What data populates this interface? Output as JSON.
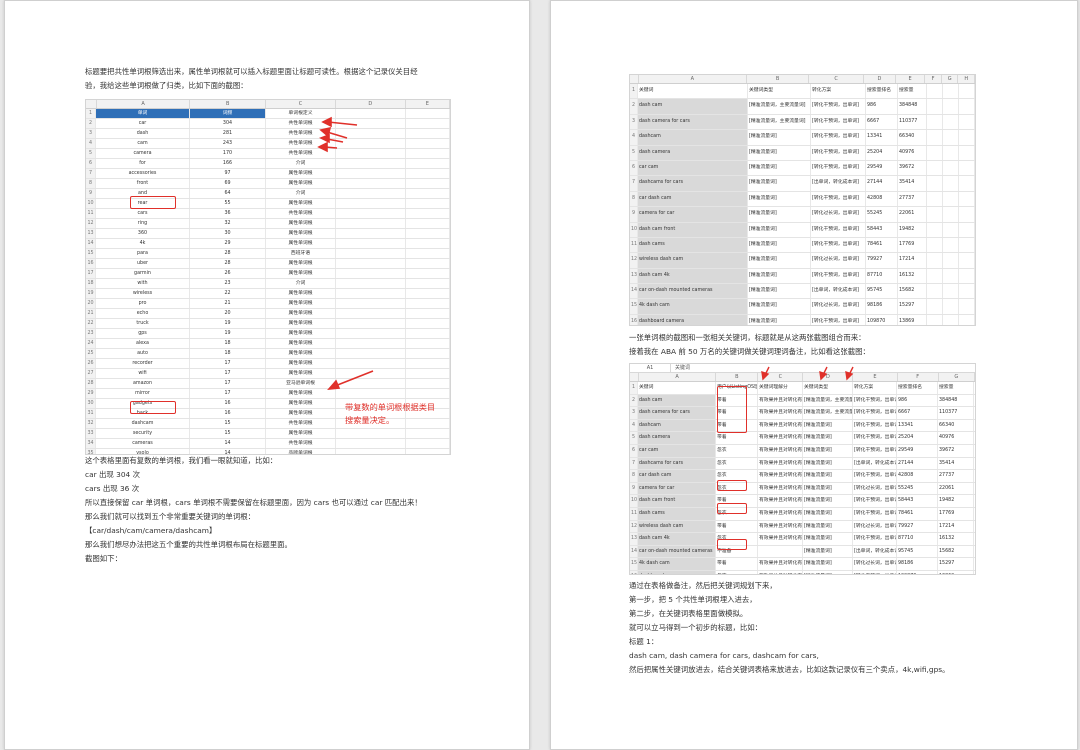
{
  "left_page": {
    "intro": [
      "标题要把共性单词根筛选出来，属性单词根就可以插入标题里面让标题可读性。根据这个记录仪关目经",
      "验，我给这些单词根做了归类，比如下面的截图："
    ],
    "sheet1": {
      "col_letters": [
        "",
        "A",
        "B",
        "C",
        "D",
        "E"
      ],
      "header": [
        "单词",
        "词频",
        "单词根定义"
      ],
      "rows": [
        [
          "car",
          "304",
          "共性单词根"
        ],
        [
          "dash",
          "281",
          "共性单词根"
        ],
        [
          "cam",
          "243",
          "共性单词根"
        ],
        [
          "camera",
          "170",
          "共性单词根"
        ],
        [
          "for",
          "166",
          "介词"
        ],
        [
          "accessories",
          "97",
          "属性单词根"
        ],
        [
          "front",
          "69",
          "属性单词根"
        ],
        [
          "and",
          "64",
          "介词"
        ],
        [
          "rear",
          "55",
          "属性单词根"
        ],
        [
          "cars",
          "36",
          "共性单词根"
        ],
        [
          "ring",
          "32",
          "属性单词根"
        ],
        [
          "360",
          "30",
          "属性单词根"
        ],
        [
          "4k",
          "29",
          "属性单词根"
        ],
        [
          "para",
          "28",
          "西班牙语"
        ],
        [
          "uber",
          "28",
          "属性单词根"
        ],
        [
          "garmin",
          "26",
          "属性单词根"
        ],
        [
          "with",
          "23",
          "介词"
        ],
        [
          "wireless",
          "22",
          "属性单词根"
        ],
        [
          "pro",
          "21",
          "属性单词根"
        ],
        [
          "echo",
          "20",
          "属性单词根"
        ],
        [
          "truck",
          "19",
          "属性单词根"
        ],
        [
          "gps",
          "19",
          "属性单词根"
        ],
        [
          "alexa",
          "18",
          "属性单词根"
        ],
        [
          "auto",
          "18",
          "属性单词根"
        ],
        [
          "recorder",
          "17",
          "属性单词根"
        ],
        [
          "wifi",
          "17",
          "属性单词根"
        ],
        [
          "amazon",
          "17",
          "亚马逊单词根"
        ],
        [
          "mirror",
          "17",
          "属性单词根"
        ],
        [
          "gadgets",
          "16",
          "属性单词根"
        ],
        [
          "back",
          "16",
          "属性单词根"
        ],
        [
          "dashcam",
          "15",
          "共性单词根"
        ],
        [
          "security",
          "15",
          "属性单词根"
        ],
        [
          "cameras",
          "14",
          "共性单词根"
        ],
        [
          "vsolo",
          "14",
          "品牌单词根"
        ],
        [
          "mini",
          "14",
          "属性单词根"
        ],
        [
          "men",
          "14",
          "属性单词根"
        ],
        [
          "women",
          "13",
          "属性单词根"
        ],
        [
          "camara",
          "13",
          "属性单词根"
        ]
      ],
      "annotation": [
        "带复数的单词根根据类目",
        "搜索量决定。"
      ]
    },
    "body": [
      "这个表格里面有复数的单词根，我们看一眼就知道，比如：",
      "car 出现 304 次",
      "cars 出现 36 次",
      "所以直接保留 car 单词根，cars 单词根不需要保留在标题里面，因为 cars 也可以通过 car 匹配出来！",
      "那么我们就可以找到五个非常重要关键词的单词根：",
      "【car/dash/cam/camera/dashcam】",
      "那么我们想尽办法把这五个重要的共性单词根布局在标题里面。",
      "截图如下："
    ]
  },
  "right_page": {
    "sheet2": {
      "col_letters": [
        "",
        "A",
        "B",
        "C",
        "D",
        "E",
        "F",
        "G",
        "H"
      ],
      "header": [
        "关键词",
        "关键词类型",
        "转化方案",
        "搜索量排名",
        "搜索量"
      ],
      "rows": [
        [
          "dash cam",
          "[精准流量词，主要流量词]",
          "[转化干预词，出单词]",
          "986",
          "384848"
        ],
        [
          "dash camera for cars",
          "[精准流量词，主要流量词]",
          "[转化干预词，出单词]",
          "6667",
          "110377"
        ],
        [
          "dashcam",
          "[精准流量词]",
          "[转化干预词，出单词]",
          "13341",
          "66340"
        ],
        [
          "dash camera",
          "[精准流量词]",
          "[转化干预词，出单词]",
          "25204",
          "40976"
        ],
        [
          "car cam",
          "[精准流量词]",
          "[转化干预词，出单词]",
          "29549",
          "39672"
        ],
        [
          "dashcams for cars",
          "[精准流量词]",
          "[出单词，转化成本词]",
          "27144",
          "35414"
        ],
        [
          "car dash cam",
          "[精准流量词]",
          "[转化干预词，出单词]",
          "42808",
          "27737"
        ],
        [
          "camera for car",
          "[精准流量词]",
          "[转化过长词，出单词]",
          "55245",
          "22061"
        ],
        [
          "dash cam front",
          "[精准流量词]",
          "[转化干预词，出单词]",
          "58443",
          "19482"
        ],
        [
          "dash cams",
          "[精准流量词]",
          "[转化干预词，出单词]",
          "78461",
          "17769"
        ],
        [
          "wireless dash cam",
          "[精准流量词]",
          "[转化过长词，出单词]",
          "79927",
          "17214"
        ],
        [
          "dash cam 4k",
          "[精准流量词]",
          "[转化干预词，出单词]",
          "87710",
          "16132"
        ],
        [
          "car on-dash mounted cameras",
          "[精准流量词]",
          "[出单词，转化成本词]",
          "95745",
          "15682"
        ],
        [
          "4k dash cam",
          "[精准流量词]",
          "[转化过长词，出单词]",
          "98186",
          "15297"
        ],
        [
          "dashboard camera",
          "[精准流量词]",
          "[转化干预词，出单词]",
          "109870",
          "13869"
        ],
        [
          "car dash camera",
          "[精准流量词]",
          "[转化干预词，出单词]",
          "133027",
          "11947"
        ]
      ]
    },
    "text_mid": [
      "一张单词根的截图和一张相关关键词，标题就是从这两张截图组合而来：",
      "接着我在 ABA 前 50 万名的关键词做关键词理词备注，比如看这张截图："
    ],
    "sheet3": {
      "formula_label": "A1",
      "formula_value": "关键词",
      "col_letters": [
        "",
        "A",
        "B",
        "C",
        "D",
        "E",
        "F",
        "G"
      ],
      "header": [
        "关键词",
        "用户以ListingOS理",
        "关键词理解分",
        "关键词类型",
        "转化方案",
        "搜索量排名",
        "搜索量"
      ],
      "rows": [
        [
          "dash cam",
          "带着",
          "有效果并且对转化有益",
          "[精准流量词，主要流量词]",
          "[转化干预词，出单词]",
          "986",
          "384848"
        ],
        [
          "dash camera for cars",
          "带着",
          "有效果并且对转化有益",
          "[精准流量词，主要流量词]",
          "[转化干预词，出单词]",
          "6667",
          "110377"
        ],
        [
          "dashcam",
          "带着",
          "有效果并且对转化有益",
          "[精准流量词]",
          "[转化干预词，出单词]",
          "13341",
          "66340"
        ],
        [
          "dash camera",
          "带着",
          "有效果并且对转化有益",
          "[精准流量词]",
          "[转化干预词，出单词]",
          "25204",
          "40976"
        ],
        [
          "car cam",
          "忽衣",
          "有效果并且对转化有益",
          "[精准流量词]",
          "[转化干预词，出单词]",
          "29549",
          "39672"
        ],
        [
          "dashcams for cars",
          "忽衣",
          "有效果并且对转化有益",
          "[精准流量词]",
          "[出单词，转化成本词]",
          "27144",
          "35414"
        ],
        [
          "car dash cam",
          "忽衣",
          "有效果并且对转化有益",
          "[精准流量词]",
          "[转化干预词，出单词]",
          "42808",
          "27737"
        ],
        [
          "camera for car",
          "忽衣",
          "有效果并且对转化有益",
          "[精准流量词]",
          "[转化过长词，出单词]",
          "55245",
          "22061"
        ],
        [
          "dash cam front",
          "带着",
          "有效果并且对转化有益",
          "[精准流量词]",
          "[转化干预词，出单词]",
          "58443",
          "19482"
        ],
        [
          "dash cams",
          "忽衣",
          "有效果并且对转化有益",
          "[精准流量词]",
          "[转化干预词，出单词]",
          "78461",
          "17769"
        ],
        [
          "wireless dash cam",
          "带着",
          "有效果并且对转化有益",
          "[精准流量词]",
          "[转化过长词，出单词]",
          "79927",
          "17214"
        ],
        [
          "dash cam 4k",
          "忽衣",
          "有效果并且对转化有益",
          "[精准流量词]",
          "[转化干预词，出单词]",
          "87710",
          "16132"
        ],
        [
          "car on-dash mounted cameras",
          "不准备",
          "",
          "[精准流量词]",
          "[出单词，转化成本词]",
          "95745",
          "15682"
        ],
        [
          "4k dash cam",
          "带着",
          "有效果并且对转化有益",
          "[精准流量词]",
          "[转化过长词，出单词]",
          "98186",
          "15297"
        ],
        [
          "dashboard camera",
          "忽衣",
          "有效果并且对转化有益",
          "[精准流量词]",
          "[转化干预词，出单词]",
          "109870",
          "13869"
        ],
        [
          "car dash camera",
          "忽衣",
          "有效果并且对转化有益",
          "[精准流量词]",
          "[转化干预词，出单词]",
          "133027",
          "11947"
        ]
      ]
    },
    "text_bottom": [
      "通过在表格做备注，然后把关键词规划下来，",
      "第一步，把 5 个共性单词根埋入进去，",
      "第二步，在关键词表格里面做模拟。",
      "就可以立马得到一个初步的标题，比如：",
      "标题 1：",
      "dash cam, dash camera for cars, dashcam for cars,",
      "然后把属性关键词放进去，结合关键词表格来放进去，比如这款记录仪有三个卖点，4k,wifi,gps。"
    ]
  }
}
